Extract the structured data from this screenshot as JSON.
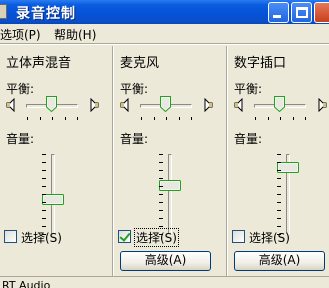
{
  "window": {
    "title": "录音控制"
  },
  "menu": {
    "options": "选项(P)",
    "help": "帮助(H)"
  },
  "labels": {
    "balance": "平衡:",
    "volume": "音量:"
  },
  "channels": [
    {
      "title": "立体声混音",
      "select_label": "选择(S)",
      "selected": false,
      "volume_level": 0.56,
      "balance": 0.5
    },
    {
      "title": "麦克风",
      "select_label": "选择(S)",
      "selected": true,
      "volume_level": 0.56,
      "balance": 0.5,
      "advanced_label": "高级(A)"
    },
    {
      "title": "数字插口",
      "select_label": "选择(S)",
      "selected": false,
      "volume_level": 0.81,
      "balance": 0.5,
      "advanced_label": "高级(A)"
    }
  ],
  "status": {
    "text": "RT Audio"
  },
  "colors": {
    "titlebar": "#0552d6",
    "window_bg": "#ece9d8",
    "check_green": "#21a121"
  }
}
